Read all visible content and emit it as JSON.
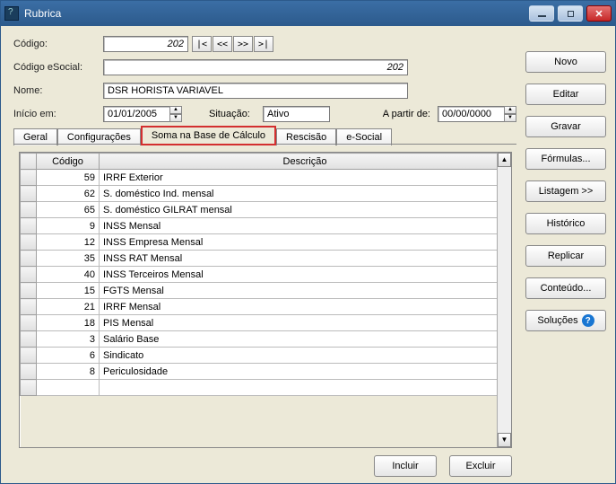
{
  "window": {
    "title": "Rubrica"
  },
  "fields": {
    "codigo_label": "Código:",
    "codigo_value": "202",
    "esocial_label": "Código eSocial:",
    "esocial_value": "202",
    "nome_label": "Nome:",
    "nome_value": "DSR HORISTA VARIAVEL",
    "inicio_label": "Início em:",
    "inicio_value": "01/01/2005",
    "situacao_label": "Situação:",
    "situacao_value": "Ativo",
    "apartir_label": "A partir de:",
    "apartir_value": "00/00/0000"
  },
  "nav": {
    "first": "|<",
    "prev": "<<",
    "next": ">>",
    "last": ">|"
  },
  "tabs": {
    "geral": "Geral",
    "config": "Configurações",
    "soma": "Soma na Base de Cálculo",
    "rescisao": "Rescisão",
    "esocial": "e-Social"
  },
  "grid": {
    "col_codigo": "Código",
    "col_descricao": "Descrição",
    "rows": [
      {
        "codigo": "59",
        "desc": "IRRF Exterior"
      },
      {
        "codigo": "62",
        "desc": "S. doméstico Ind. mensal"
      },
      {
        "codigo": "65",
        "desc": "S. doméstico GILRAT mensal"
      },
      {
        "codigo": "9",
        "desc": "INSS Mensal"
      },
      {
        "codigo": "12",
        "desc": "INSS Empresa Mensal"
      },
      {
        "codigo": "35",
        "desc": "INSS RAT Mensal"
      },
      {
        "codigo": "40",
        "desc": "INSS Terceiros Mensal"
      },
      {
        "codigo": "15",
        "desc": "FGTS Mensal"
      },
      {
        "codigo": "21",
        "desc": "IRRF Mensal"
      },
      {
        "codigo": "18",
        "desc": "PIS Mensal"
      },
      {
        "codigo": "3",
        "desc": "Salário Base"
      },
      {
        "codigo": "6",
        "desc": "Sindicato"
      },
      {
        "codigo": "8",
        "desc": "Periculosidade"
      }
    ]
  },
  "buttons": {
    "novo": "Novo",
    "editar": "Editar",
    "gravar": "Gravar",
    "formulas": "Fórmulas...",
    "listagem": "Listagem >>",
    "historico": "Histórico",
    "replicar": "Replicar",
    "conteudo": "Conteúdo...",
    "solucoes": "Soluções",
    "incluir": "Incluir",
    "excluir": "Excluir"
  }
}
